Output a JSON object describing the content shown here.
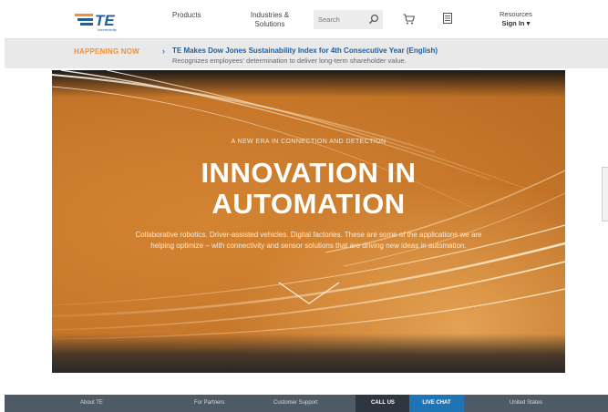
{
  "header": {
    "logo_text": "TE",
    "logo_sub": "connectivity",
    "nav": {
      "products": "Products",
      "industries_line1": "Industries &",
      "industries_line2": "Solutions"
    },
    "search": {
      "placeholder": "Search"
    },
    "resources": {
      "label": "Resources",
      "signin": "Sign In ▾"
    }
  },
  "happening": {
    "label": "HAPPENING NOW",
    "chevron": "›",
    "title": "TE Makes Dow Jones Sustainability Index for 4th Consecutive Year (English)",
    "subtitle": "Recognizes employees' determination to deliver long-term shareholder value."
  },
  "hero": {
    "kicker": "A NEW ERA IN CONNECTION AND DETECTION",
    "title_line1": "INNOVATION IN",
    "title_line2": "AUTOMATION",
    "desc_line1": "Collaborative robotics. Driver-assisted vehicles. Digital factories. These are some of the applications we are",
    "desc_line2": "helping optimize – with connectivity and sensor solutions that are driving new ideas in automation."
  },
  "footer": {
    "about": "About TE",
    "partners": "For Partners",
    "support": "Customer Support",
    "call_us": "CALL US",
    "live_chat": "LIVE CHAT",
    "country": "United States"
  },
  "colors": {
    "brand_orange": "#f0903a",
    "link_blue": "#1f5f9a",
    "footer_bg": "#4f5a67",
    "live_chat_blue": "#1e74b5"
  }
}
